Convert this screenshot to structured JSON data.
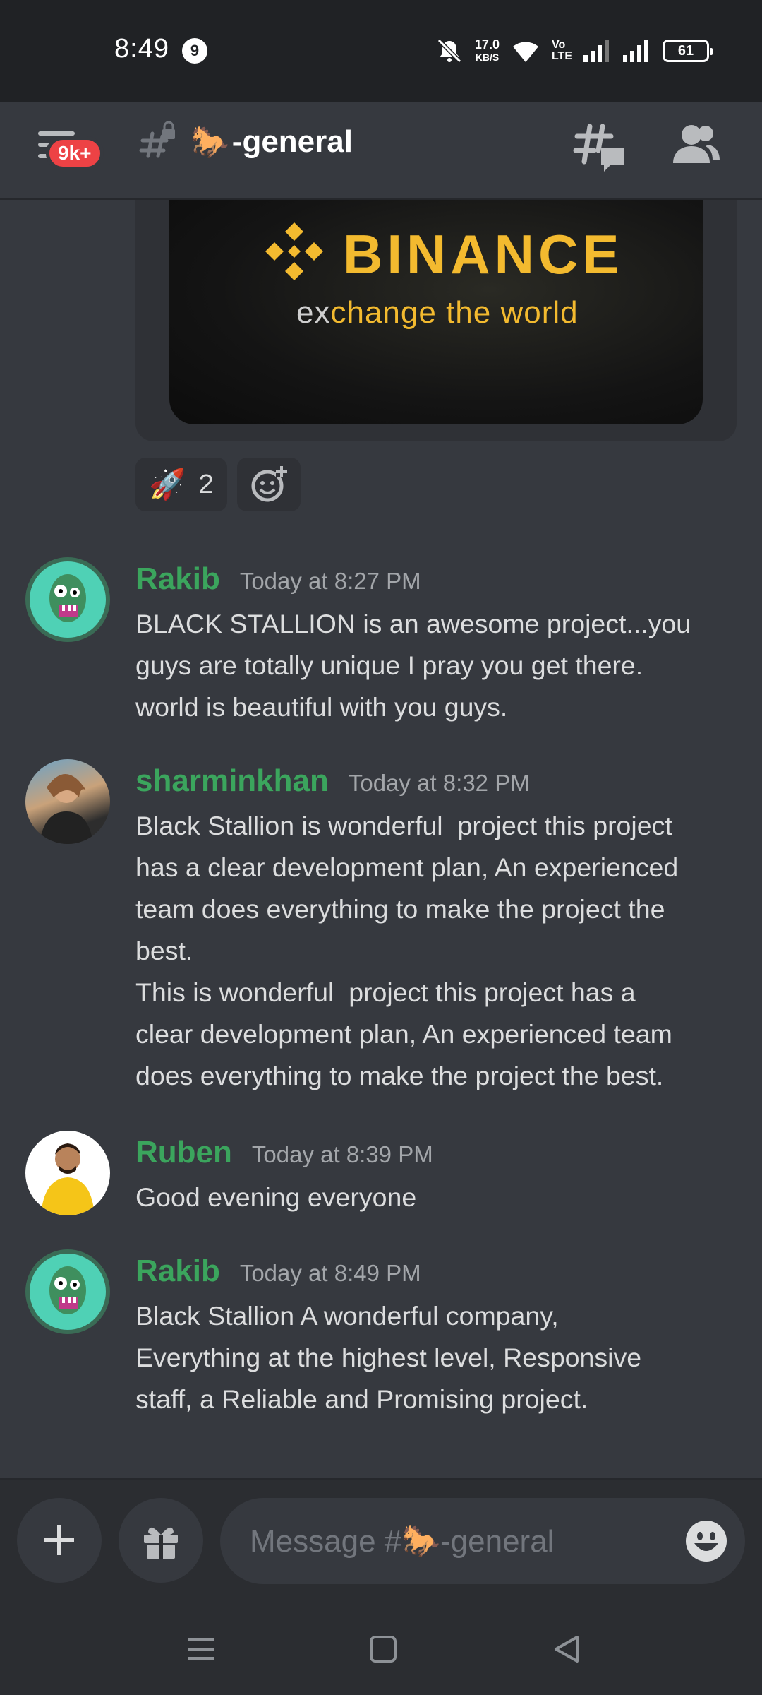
{
  "status_bar": {
    "time": "8:49",
    "notification_count": "9",
    "net_speed_value": "17.0",
    "net_speed_unit": "KB/S",
    "volte_top": "Vo",
    "volte_bottom": "LTE",
    "battery": "61"
  },
  "header": {
    "unread_badge": "9k+",
    "channel_emoji": "🐎",
    "channel_name": "-general"
  },
  "embed": {
    "brand": "BINANCE",
    "tagline_prefix": "ex",
    "tagline_rest": "change the world"
  },
  "reactions": [
    {
      "emoji": "🚀",
      "count": "2"
    }
  ],
  "messages": [
    {
      "author": "Rakib",
      "timestamp": "Today at 8:27 PM",
      "text": "BLACK STALLION is an awesome project...you\nguys are totally unique I pray you get there.\nworld is beautiful with you guys."
    },
    {
      "author": "sharminkhan",
      "timestamp": "Today at 8:32 PM",
      "text": "Black Stallion is wonderful  project this project\nhas a clear development plan, An experienced\nteam does everything to make the project the\nbest.\nThis is wonderful  project this project has a\nclear development plan, An experienced team\ndoes everything to make the project the best."
    },
    {
      "author": "Ruben",
      "timestamp": "Today at 8:39 PM",
      "text": "Good evening everyone"
    },
    {
      "author": "Rakib",
      "timestamp": "Today at 8:49 PM",
      "text": "Black Stallion A wonderful company,\nEverything at the highest level, Responsive\nstaff, a Reliable and Promising project."
    }
  ],
  "composer": {
    "placeholder": "Message #🐎-general"
  },
  "colors": {
    "background": "#36393f",
    "username": "#3ba55d",
    "badge": "#ed4245",
    "binance_yellow": "#f3ba2f"
  },
  "icons": [
    "hamburger-icon",
    "hash-lock-icon",
    "threads-icon",
    "members-icon",
    "add-reaction-icon",
    "plus-icon",
    "gift-icon",
    "emoji-icon",
    "nav-menu-icon",
    "nav-home-icon",
    "nav-back-icon"
  ]
}
